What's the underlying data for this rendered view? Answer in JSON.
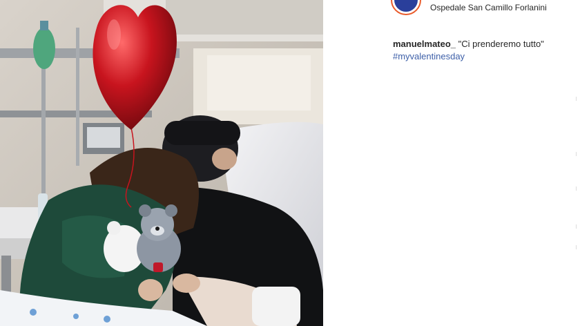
{
  "post": {
    "location": "Ospedale San Camillo Forlanini",
    "username": "manuelmateo_",
    "caption_text": "\"Ci prenderemo tutto\"",
    "hashtag": "#myvalentinesday"
  },
  "icons": {
    "avatar": "hospital-logo-avatar"
  },
  "colors": {
    "text": "#262626",
    "hashtag": "#3d5fa8",
    "avatar_ring": "#e95b2b",
    "avatar_fill": "#2a3f9b",
    "balloon": "#c8141e"
  }
}
